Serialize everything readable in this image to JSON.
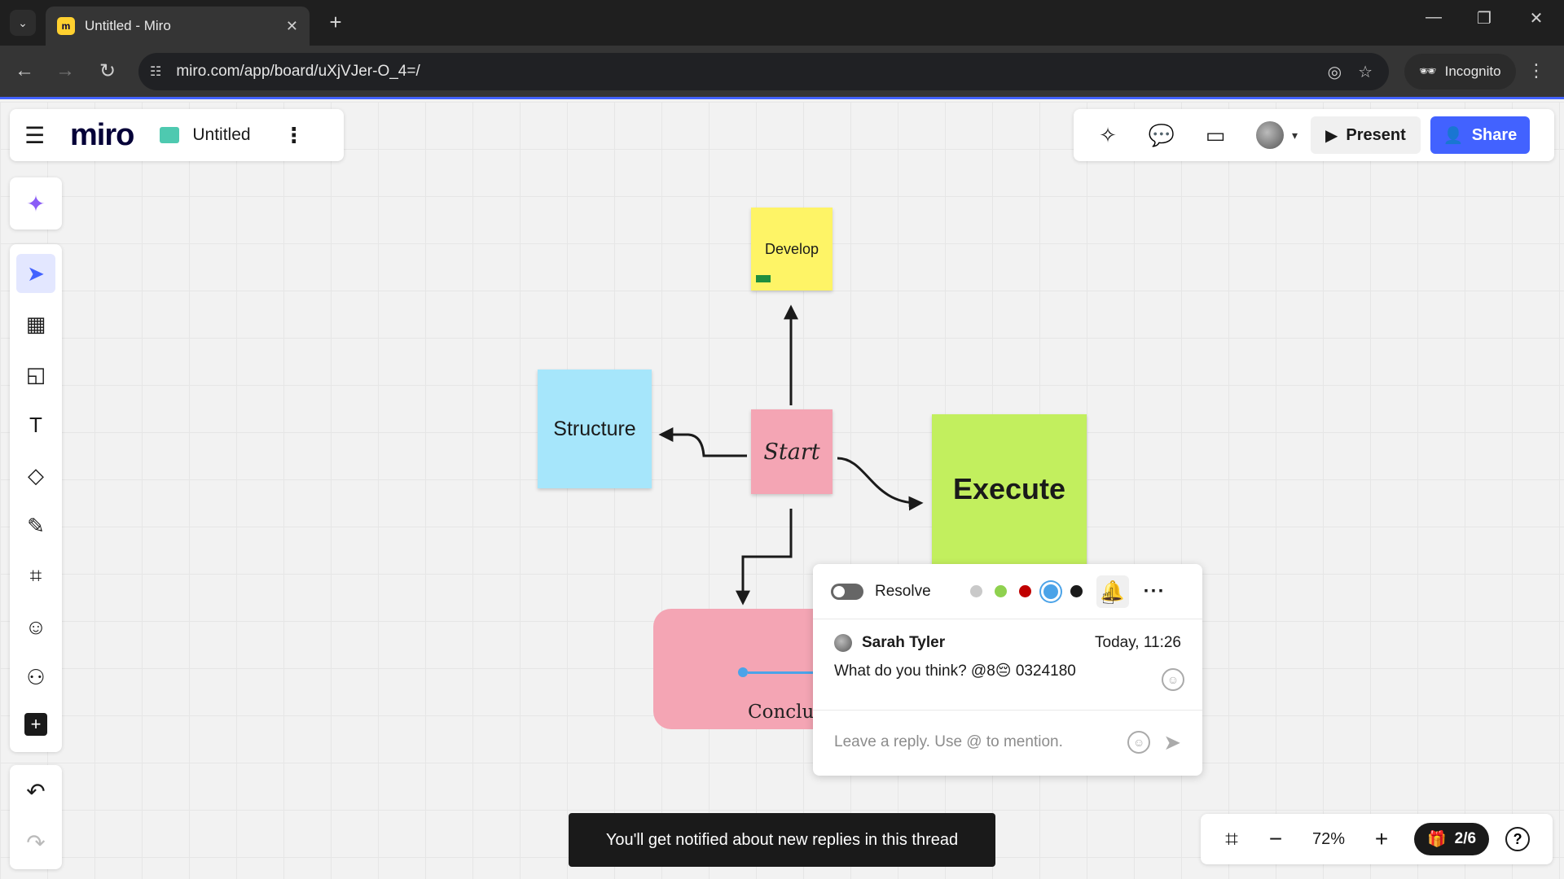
{
  "browser": {
    "tab_title": "Untitled - Miro",
    "favicon_letter": "m",
    "url": "miro.com/app/board/uXjVJer-O_4=/",
    "incognito_label": "Incognito"
  },
  "board_header": {
    "logo": "miro",
    "board_name": "Untitled"
  },
  "top_right": {
    "present_label": "Present",
    "share_label": "Share"
  },
  "toolbar": {
    "tools": [
      "select-tool",
      "templates-tool",
      "sticky-note-tool",
      "text-tool",
      "shapes-tool",
      "pen-tool",
      "frame-tool",
      "stickers-tool",
      "more-apps-tool",
      "add-tool"
    ]
  },
  "stickies": {
    "develop": "Develop",
    "structure": "Structure",
    "start": "Start",
    "execute": "Execute",
    "conclude_partial": "Concluc"
  },
  "thread": {
    "resolve_label": "Resolve",
    "colors": [
      "#c9c9c9",
      "#8fd14f",
      "#c00000",
      "#4ba3e8",
      "#1a1a1a"
    ],
    "selected_color_index": 3,
    "author": "Sarah Tyler",
    "time": "Today, 11:26",
    "message": "What do you think? @8😔 0324180",
    "reply_placeholder": "Leave a reply. Use @ to mention."
  },
  "zoom": {
    "value": "72%",
    "frames": "2/6"
  },
  "toast": "You'll get notified about new replies in this thread",
  "colors": {
    "accent": "#4262ff",
    "sticky_yellow": "#fef466",
    "sticky_blue": "#a6e6fb",
    "sticky_pink": "#f4a5b4",
    "sticky_green": "#c2ef5e"
  }
}
